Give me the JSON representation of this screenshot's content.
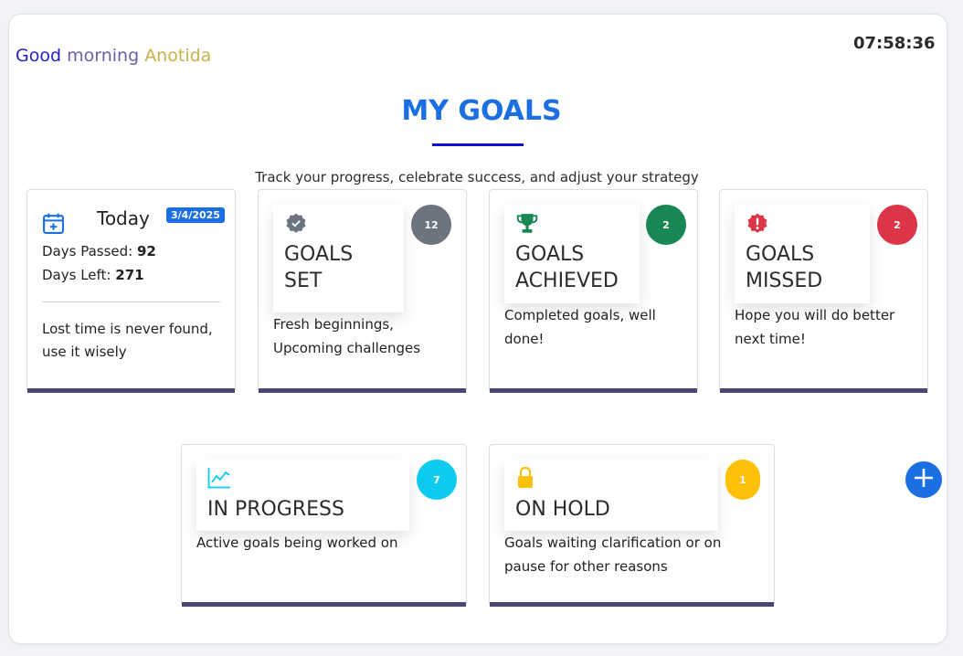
{
  "greeting": {
    "word1": "Good",
    "word2": "morning",
    "name": "Anotida"
  },
  "clock": "07:58:36",
  "page": {
    "title": "MY GOALS",
    "subtitle": "Track your progress, celebrate success, and adjust your strategy"
  },
  "today": {
    "label": "Today",
    "date": "3/4/2025",
    "days_passed_label": "Days Passed:",
    "days_passed": "92",
    "days_left_label": "Days Left:",
    "days_left": "271",
    "quote": "Lost time is never found, use it wisely",
    "icon": "calendar-plus-icon"
  },
  "cards": {
    "set": {
      "line1": "GOALS",
      "line2": "SET",
      "count": "12",
      "desc": "Fresh beginnings, Upcoming challenges",
      "icon": "badge-check-icon",
      "color": "#6c757d"
    },
    "achieved": {
      "line1": "GOALS",
      "line2": "ACHIEVED",
      "count": "2",
      "desc": "Completed goals, well done!",
      "icon": "trophy-icon",
      "color": "#198754"
    },
    "missed": {
      "line1": "GOALS",
      "line2": "MISSED",
      "count": "2",
      "desc": "Hope you will do better next time!",
      "icon": "exclamation-badge-icon",
      "color": "#dc3545"
    },
    "progress": {
      "line1": "IN PROGRESS",
      "count": "7",
      "desc": "Active goals being worked on",
      "icon": "line-chart-icon",
      "color": "#0dcaf0"
    },
    "hold": {
      "line1": "ON HOLD",
      "count": "1",
      "desc": "Goals waiting clarification or on pause for other reasons",
      "icon": "lock-icon",
      "color": "#ffc107"
    }
  },
  "add_button": {
    "icon": "plus-icon"
  }
}
